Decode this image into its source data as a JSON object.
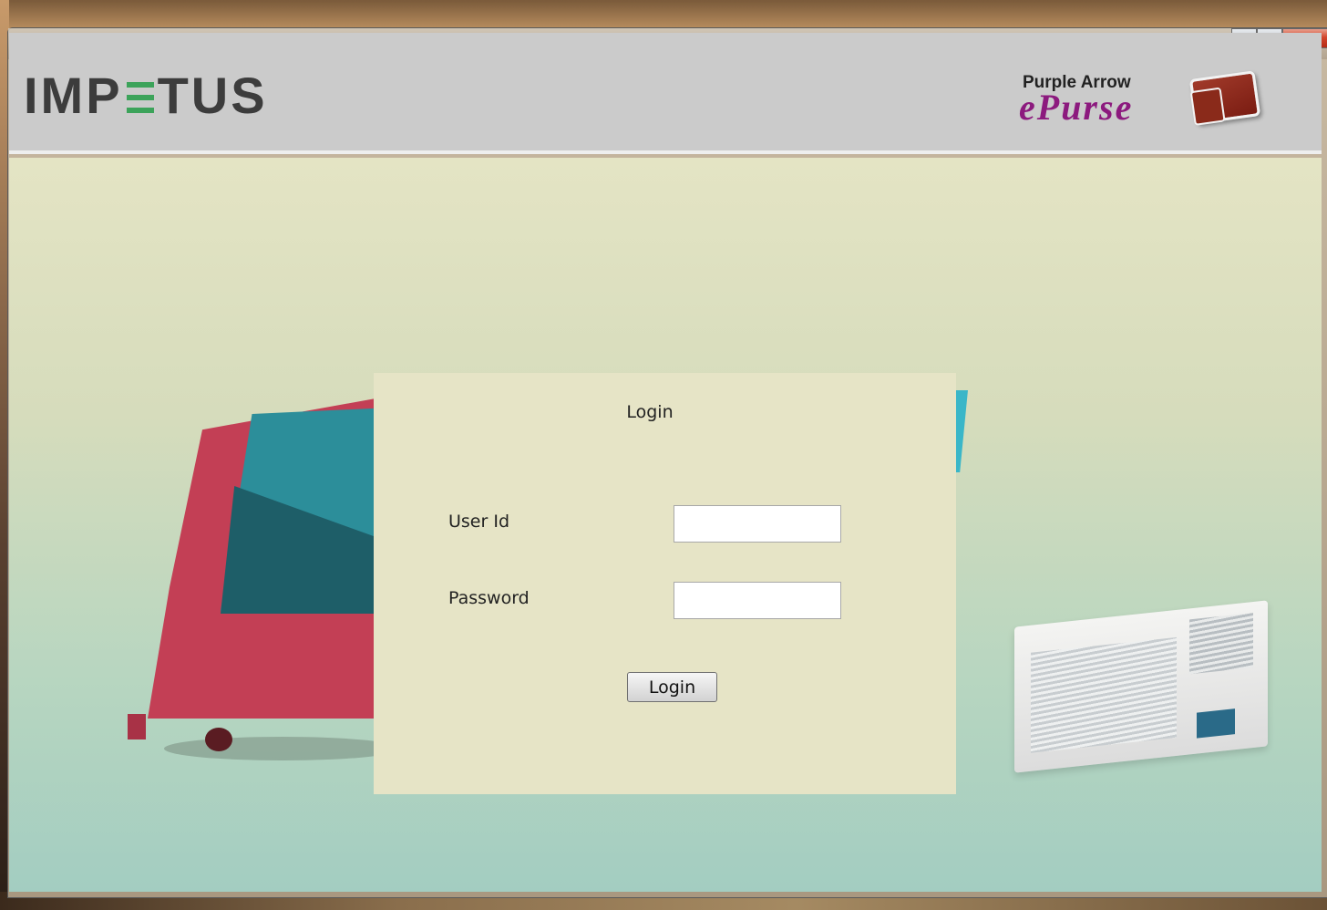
{
  "window": {
    "icons": {
      "app": "java-app-icon",
      "minimize": "minimize-icon",
      "maximize": "maximize-icon",
      "close": "close-icon"
    },
    "close_glyph": "x"
  },
  "header": {
    "brand_left": {
      "prefix": "IMP",
      "suffix": "TUS"
    },
    "brand_right": {
      "top": "Purple Arrow",
      "script": "ePurse",
      "icon": "wallet-icon"
    }
  },
  "login": {
    "title": "Login",
    "user_id_label": "User Id",
    "user_id_value": "",
    "password_label": "Password",
    "password_value": "",
    "button_label": "Login"
  },
  "colors": {
    "header_bg": "#cbcbcb",
    "panel_bg": "#e6e4c6",
    "brand_green": "#3ca35a",
    "brand_purple": "#8c1a7e"
  }
}
